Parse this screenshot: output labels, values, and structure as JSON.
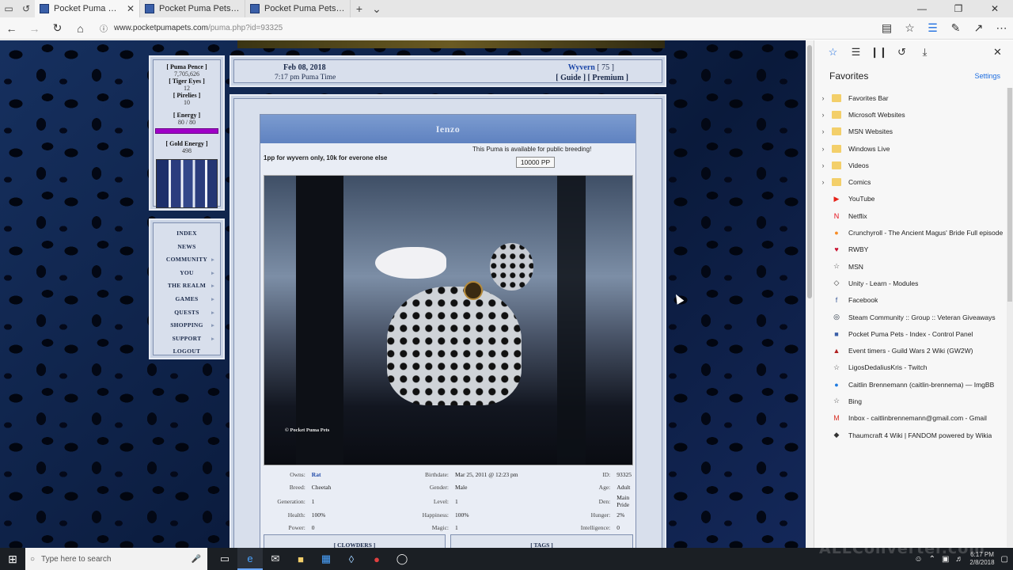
{
  "browser": {
    "tabs": [
      {
        "label": "Pocket Puma Pets - Ienz",
        "active": true
      },
      {
        "label": "Pocket Puma Pets - Index /",
        "active": false
      },
      {
        "label": "Pocket Puma Pets - Forum",
        "active": false
      }
    ],
    "url_host": "www.pocketpumapets.com",
    "url_path": "/puma.php?id=93325"
  },
  "site": {
    "stats": {
      "pence_label": "[ Puma Pence ]",
      "pence_value": "7,705,626",
      "tiger_label": "[ Tiger Eyes ]",
      "tiger_value": "12",
      "firefly_label": "[ Pirelies ]",
      "firefly_value": "10",
      "energy_label": "[ Energy ]",
      "energy_value": "80 / 80",
      "energy_fraction": 1.0,
      "energy_color": "#a000c8",
      "gold_label": "[ Gold Energy ]",
      "gold_value": "498"
    },
    "nav": [
      "INDEX",
      "NEWS",
      "COMMUNITY",
      "YOU",
      "THE REALM",
      "GAMES",
      "QUESTS",
      "SHOPPING",
      "SUPPORT",
      "LOGOUT"
    ],
    "topinfo": {
      "date": "Feb 08, 2018",
      "time": "7:17 pm Puma Time",
      "user": "Wyvern",
      "user_level": "[ 75 ]",
      "guide": "[ Guide ]",
      "premium": "[ Premium ]"
    },
    "pet": {
      "name": "Ienzo",
      "note": "1pp for wyvern only, 10k for everone else",
      "breeding_text": "This Puma is available for public breeding!",
      "price": "10000 PP",
      "copyright": "© Pocket Puma Pets",
      "rows": [
        [
          "Owns:",
          "Rat",
          "Birthdate:",
          "Mar 25, 2011 @ 12:23 pm",
          "ID:",
          "93325"
        ],
        [
          "Breed:",
          "Cheetah",
          "Gender:",
          "Male",
          "Age:",
          "Adult"
        ],
        [
          "Generation:",
          "1",
          "Level:",
          "1",
          "Den:",
          "Main Pride"
        ],
        [
          "Health:",
          "100%",
          "Happiness:",
          "100%",
          "Hunger:",
          "2%"
        ],
        [
          "Power:",
          "0",
          "Magic:",
          "1",
          "Intelligence:",
          "0"
        ]
      ],
      "box_left": "[ CLOWDERS ]",
      "box_right": "[ TAGS ]"
    }
  },
  "hub": {
    "title": "Favorites",
    "settings": "Settings",
    "items": [
      {
        "label": "Favorites Bar",
        "folder": true,
        "icon": "folder-icon"
      },
      {
        "label": "Microsoft Websites",
        "folder": true,
        "icon": "folder-icon"
      },
      {
        "label": "MSN Websites",
        "folder": true,
        "icon": "folder-icon"
      },
      {
        "label": "Windows Live",
        "folder": true,
        "icon": "folder-icon"
      },
      {
        "label": "Videos",
        "folder": true,
        "icon": "folder-icon"
      },
      {
        "label": "Comics",
        "folder": true,
        "icon": "folder-icon"
      },
      {
        "label": "YouTube",
        "folder": false,
        "icon": "youtube-icon"
      },
      {
        "label": "Netflix",
        "folder": false,
        "icon": "netflix-icon"
      },
      {
        "label": "Crunchyroll - The Ancient Magus' Bride Full episode",
        "folder": false,
        "icon": "crunchyroll-icon"
      },
      {
        "label": "RWBY",
        "folder": false,
        "icon": "rwby-icon"
      },
      {
        "label": "MSN",
        "folder": false,
        "icon": "star-outline-icon"
      },
      {
        "label": "Unity - Learn - Modules",
        "folder": false,
        "icon": "unity-icon"
      },
      {
        "label": "Facebook",
        "folder": false,
        "icon": "facebook-icon"
      },
      {
        "label": "Steam Community :: Group :: Veteran Giveaways",
        "folder": false,
        "icon": "steam-icon"
      },
      {
        "label": "Pocket Puma Pets - Index - Control Panel",
        "folder": false,
        "icon": "pocketpuma-icon"
      },
      {
        "label": "Event timers - Guild Wars 2 Wiki (GW2W)",
        "folder": false,
        "icon": "gw2-icon"
      },
      {
        "label": "LigosDedaliusKris - Twitch",
        "folder": false,
        "icon": "star-outline-icon"
      },
      {
        "label": "Caitlin Brennemann (caitlin-brennema) — ImgBB",
        "folder": false,
        "icon": "imgbb-icon"
      },
      {
        "label": "Bing",
        "folder": false,
        "icon": "star-outline-icon"
      },
      {
        "label": "Inbox - caitlinbrennemann@gmail.com - Gmail",
        "folder": false,
        "icon": "gmail-icon"
      },
      {
        "label": "Thaumcraft 4 Wiki | FANDOM powered by Wikia",
        "folder": false,
        "icon": "fandom-icon"
      }
    ]
  },
  "taskbar": {
    "search_placeholder": "Type here to search",
    "time": "6:17 PM",
    "date": "2/8/2018"
  },
  "watermark": "ALLConverter.com"
}
